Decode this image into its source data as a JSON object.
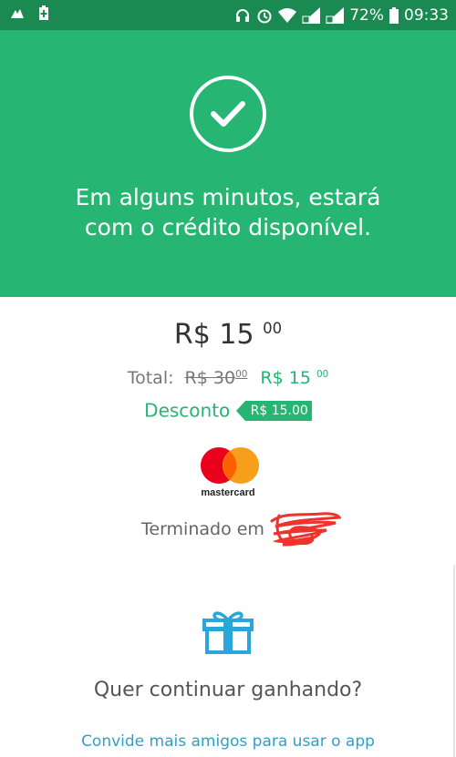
{
  "status_bar": {
    "battery_percent": "72%",
    "time": "09:33",
    "icons": [
      "app-notification-icon",
      "battery-saver-icon",
      "headset-icon",
      "alarm-icon",
      "wifi-icon",
      "signal-icon",
      "signal-icon",
      "battery-icon"
    ]
  },
  "hero": {
    "icon": "check-circle-icon",
    "message": "Em alguns minutos, estará com o crédito disponível."
  },
  "payment": {
    "amount_main": "R$ 15",
    "amount_cents": "00",
    "total_label": "Total:",
    "old_price_main": "R$ 30",
    "old_price_cents": "00",
    "new_price_main": "R$ 15",
    "new_price_cents": "00",
    "discount_label": "Desconto",
    "discount_value": "R$ 15.00"
  },
  "card": {
    "brand": "mastercard",
    "ending_label": "Terminado em"
  },
  "promo": {
    "icon": "gift-icon",
    "title": "Quer continuar ganhando?",
    "link": "Convide mais amigos para usar o app"
  },
  "colors": {
    "primary_green": "#26b572",
    "status_bar_green": "#1a8a52",
    "link_blue": "#2fa0c8",
    "gift_blue": "#2aa7d8"
  }
}
